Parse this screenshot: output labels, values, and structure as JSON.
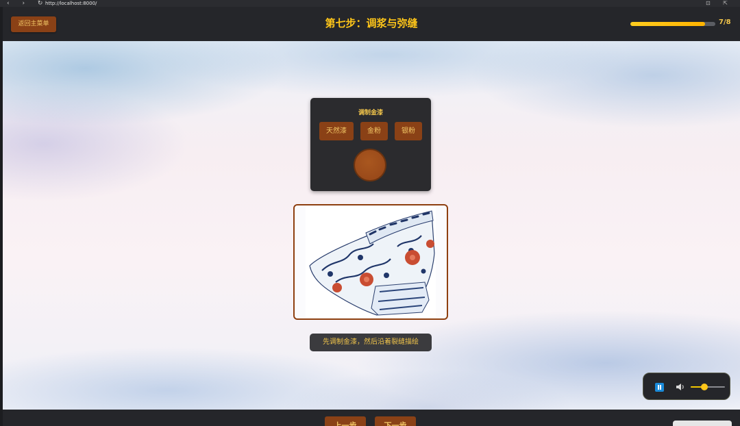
{
  "browser": {
    "nav_icons": "‹ › ↻",
    "url": "http://localhost:8000/",
    "right_icons": "⊡ ⇱"
  },
  "header": {
    "back_label": "返回主菜单",
    "title": "第七步：调浆与弥缝",
    "progress": {
      "current": 7,
      "total": 8,
      "text": "7/8"
    }
  },
  "mixing": {
    "title": "调制金漆",
    "materials": [
      "天然漆",
      "金粉",
      "银粉"
    ],
    "mix_color": "#9a4a1a"
  },
  "artifact": {
    "icon": "blue-white-porcelain-bowl-image"
  },
  "hint": "先调制金漆，然后沿着裂缝描绘",
  "audio": {
    "state": "playing",
    "volume": 0.4
  },
  "footer": {
    "prev_label": "上一步",
    "next_label": "下一步"
  },
  "colors": {
    "accent": "#ffc619",
    "button_bg": "#8a4116",
    "panel_bg": "#2b2b2e"
  }
}
